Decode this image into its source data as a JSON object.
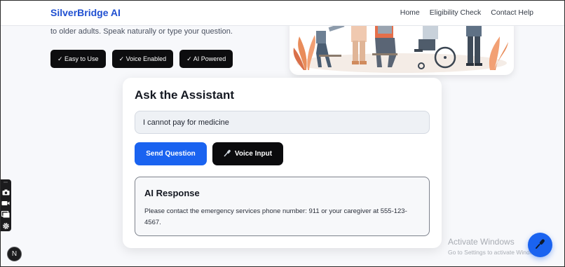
{
  "header": {
    "brand": "SilverBridge AI",
    "nav": [
      "Home",
      "Eligibility Check",
      "Contact Help"
    ]
  },
  "intro": {
    "text": "to older adults. Speak naturally or type your question.",
    "badges": [
      "✓ Easy to Use",
      "✓ Voice Enabled",
      "✓ AI Powered"
    ]
  },
  "assistant": {
    "title": "Ask the Assistant",
    "input_value": "I cannot pay for medicine",
    "send_label": "Send Question",
    "voice_label": "Voice Input",
    "response_title": "AI Response",
    "response_text": "Please contact the emergency services phone number: 911 or your caregiver at 555-123-4567."
  },
  "watermark": {
    "title": "Activate Windows",
    "subtitle": "Go to Settings to activate Windows."
  },
  "avatar_letter": "N",
  "icons": {
    "voice": "microphone-icon",
    "fab": "microphone-icon",
    "toolbar": [
      "camera-icon",
      "video-icon",
      "screenshot-icon",
      "settings-icon"
    ]
  },
  "colors": {
    "brand": "#1f4fd1",
    "primary": "#1a63f0",
    "dark": "#0b0b0d"
  }
}
